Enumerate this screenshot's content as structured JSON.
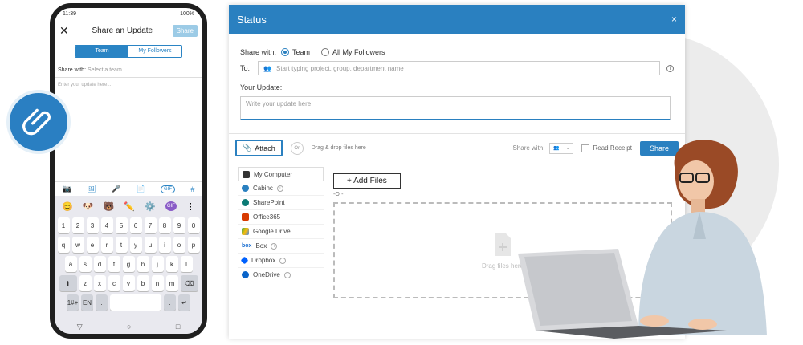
{
  "phone": {
    "status_time": "11:39",
    "status_right": "100%",
    "header_title": "Share an Update",
    "share_label": "Share",
    "tabs": [
      "Team",
      "My Followers"
    ],
    "share_with_label": "Share with:",
    "share_with_placeholder": "Select a team",
    "update_placeholder": "Enter your update here...",
    "toolbar_gif": "GIF",
    "toolbar_hash": "#",
    "kb_rows": [
      [
        "1",
        "2",
        "3",
        "4",
        "5",
        "6",
        "7",
        "8",
        "9",
        "0"
      ],
      [
        "q",
        "w",
        "e",
        "r",
        "t",
        "y",
        "u",
        "i",
        "o",
        "p"
      ],
      [
        "a",
        "s",
        "d",
        "f",
        "g",
        "h",
        "j",
        "k",
        "l"
      ],
      [
        "z",
        "x",
        "c",
        "v",
        "b",
        "n",
        "m"
      ]
    ],
    "kb_bottom": [
      "1#+",
      "EN",
      ".",
      ".",
      "↵"
    ],
    "emoji_gif": "GIF"
  },
  "dialog": {
    "title": "Status",
    "close": "×",
    "share_with_label": "Share with:",
    "radio_team": "Team",
    "radio_followers": "All My Followers",
    "to_label": "To:",
    "to_placeholder": "Start typing project, group, department name",
    "your_update_label": "Your Update:",
    "update_placeholder": "Write your update here",
    "attach_label": "Attach",
    "or_label": "Or",
    "drag_hint": "Drag & drop files here",
    "share_with_small": "Share with:",
    "read_receipt": "Read Receipt",
    "share_button": "Share",
    "sources": [
      {
        "label": "My Computer",
        "color": "#333333",
        "info": false
      },
      {
        "label": "Cabinc",
        "color": "#2a80c0",
        "info": true
      },
      {
        "label": "SharePoint",
        "color": "#0b7a75",
        "info": false
      },
      {
        "label": "Office365",
        "color": "#d83b01",
        "info": false
      },
      {
        "label": "Google Drive",
        "color": "#34a853",
        "info": false
      },
      {
        "label": "Box",
        "color": "#1a6fd1",
        "info": true
      },
      {
        "label": "Dropbox",
        "color": "#0061fe",
        "info": true
      },
      {
        "label": "OneDrive",
        "color": "#0a64c9",
        "info": true
      }
    ],
    "add_files": "+ Add Files",
    "or_small": "-Or-",
    "drag_files": "Drag files here"
  },
  "colors": {
    "accent": "#2a80c0"
  }
}
